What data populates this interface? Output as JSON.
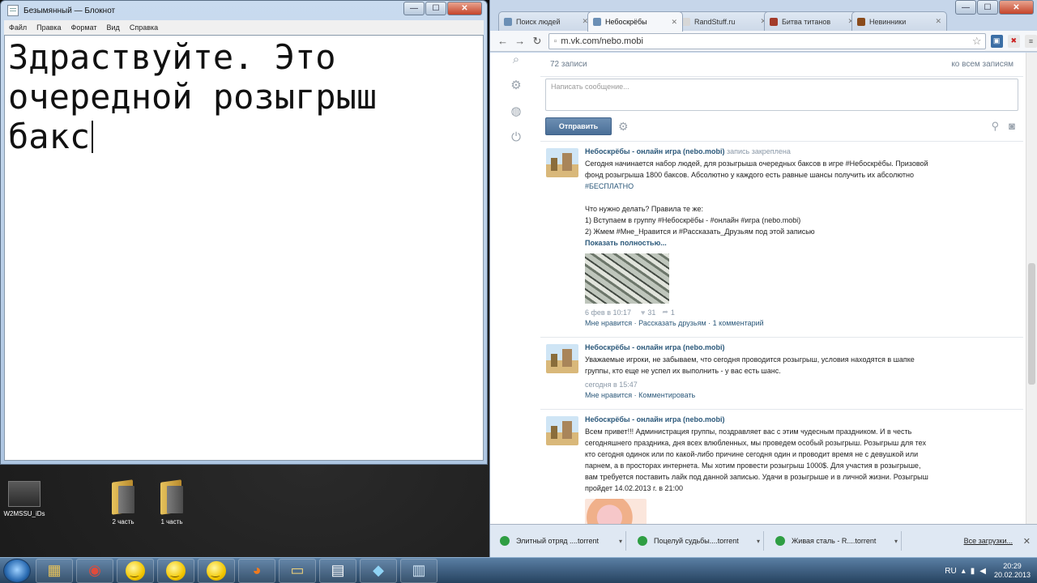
{
  "notepad": {
    "title": "Безымянный — Блокнот",
    "menu": [
      "Файл",
      "Правка",
      "Формат",
      "Вид",
      "Справка"
    ],
    "text": "Здраствуйте. Это\nочередной розыгрыш\nбакс"
  },
  "window_controls": {
    "minimize": "—",
    "maximize": "☐",
    "close": "✕"
  },
  "desktop": {
    "icons": [
      {
        "label": "W2MSSU_iDs"
      },
      {
        "label": "2 часть"
      },
      {
        "label": "1 часть"
      }
    ]
  },
  "browser": {
    "tabs": [
      {
        "label": "Поиск людей",
        "color": "#6b8fb5"
      },
      {
        "label": "Небоскрёбы",
        "color": "#6b8fb5"
      },
      {
        "label": "RandStuff.ru",
        "color": "#d7d7d7"
      },
      {
        "label": "Битва титанов",
        "color": "#a33b2a"
      },
      {
        "label": "Невинники",
        "color": "#8a4b1c"
      }
    ],
    "active_tab": 1,
    "url": "m.vk.com/nebo.mobi",
    "page": {
      "post_count": "72 записи",
      "my_posts": "ко всем записям",
      "message_placeholder": "Написать сообщение...",
      "send_label": "Отправить",
      "posts": [
        {
          "author": "Небоскрёбы - онлайн игра (nebo.mobi)",
          "note": "запись закреплена",
          "text_lines": [
            "Сегодня начинается набор людей, для розыгрыша очередных баксов в игре #Небоскрёбы. Призовой",
            "фонд розыгрыша 1800 баксов. Абсолютно у каждого есть равные шансы получить их абсолютно",
            "#БЕСПЛАТНО",
            "",
            "Что нужно делать? Правила те же:",
            "1) Вступаем в группу #Небоскрёбы - #онлайн #игра (nebo.mobi)",
            "2) Жмем #Мне_Нравится и #Рассказать_Друзьям под этой записью"
          ],
          "show_more": "Показать полностью...",
          "date": "6 фев в 10:17",
          "likes": "31",
          "shares": "1",
          "actions": "Мне нравится · Рассказать друзьям · 1 комментарий"
        },
        {
          "author": "Небоскрёбы - онлайн игра (nebo.mobi)",
          "text_lines": [
            "Уважаемые игроки, не забываем, что сегодня проводится розыгрыш, условия находятся в шапке",
            "группы, кто еще не успел их выполнить - у вас есть шанс."
          ],
          "date": "сегодня в 15:47",
          "actions": "Мне нравится · Комментировать"
        },
        {
          "author": "Небоскрёбы - онлайн игра (nebo.mobi)",
          "text_lines": [
            "Всем привет!!! Администрация группы, поздравляет вас с этим чудесным праздником. И в честь",
            "сегодняшнего праздника, дня всех влюбленных, мы проведем особый розыгрыш. Розыгрыш для тех",
            "кто сегодня одинок или по какой-либо причине сегодня один и проводит время не с девушкой или",
            "парнем, а в просторах интернета. Мы хотим провести розыгрыш 1000$. Для участия в розыгрыше,",
            "вам требуется поставить лайк под данной записью. Удачи в розыгрыше и в личной жизни. Розыгрыш",
            "пройдет 14.02.2013 г. в 21:00"
          ]
        }
      ]
    },
    "downloads": [
      {
        "label": "Элитный отряд ....torrent"
      },
      {
        "label": "Поцелуй судьбы....torrent"
      },
      {
        "label": "Живая сталь - R....torrent"
      }
    ],
    "all_downloads": "Все загрузки..."
  },
  "taskbar": {
    "lang": "RU",
    "time": "20:29",
    "date": "20.02.2013"
  }
}
